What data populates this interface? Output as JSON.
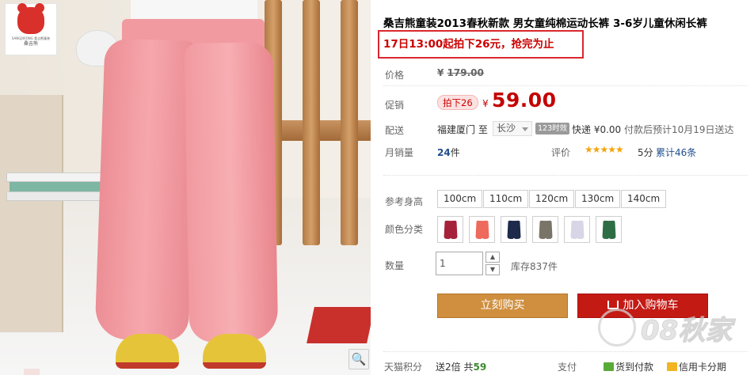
{
  "brand": {
    "tagline": "SANGJIXIONG 桑吉熊童装",
    "name": "桑吉熊"
  },
  "product": {
    "title": "桑吉熊童装2013春秋新款 男女童纯棉运动长裤 3-6岁儿童休闲长裤",
    "promo_text": "17日13:00起拍下26元，抢完为止"
  },
  "price": {
    "label": "价格",
    "currency": "¥",
    "original": "179.00"
  },
  "promotion": {
    "label": "促销",
    "tag": "拍下26",
    "currency": "¥",
    "price": "59.00"
  },
  "shipping": {
    "label": "配送",
    "from": "福建厦门",
    "to_word": "至",
    "destination": "长沙",
    "badge": "123时效",
    "express": "快递 ¥0.00",
    "estimate": "付款后预计10月19日送达"
  },
  "sales": {
    "label": "月销量",
    "count": "24",
    "unit": "件"
  },
  "rating": {
    "label": "评价",
    "stars": "★★★★★",
    "score": "5分",
    "total": "累计46条"
  },
  "options": {
    "size_label": "参考身高",
    "sizes": [
      "100cm",
      "110cm",
      "120cm",
      "130cm",
      "140cm"
    ],
    "color_label": "颜色分类",
    "colors": [
      "#a6223a",
      "#ee6a5c",
      "#1e2a4a",
      "#7a7468",
      "#d8d6e6",
      "#2e6e45"
    ]
  },
  "quantity": {
    "label": "数量",
    "value": "1",
    "stock": "库存837件"
  },
  "actions": {
    "buy": "立刻购买",
    "cart": "加入购物车"
  },
  "watermark": "08秋家",
  "footer": {
    "tmall_label": "天猫积分",
    "tmall_gift": "送2倍",
    "tmall_total_prefix": "共",
    "tmall_total": "59",
    "pay_label": "支付",
    "pay_cod": "货到付款",
    "pay_credit": "信用卡分期"
  }
}
